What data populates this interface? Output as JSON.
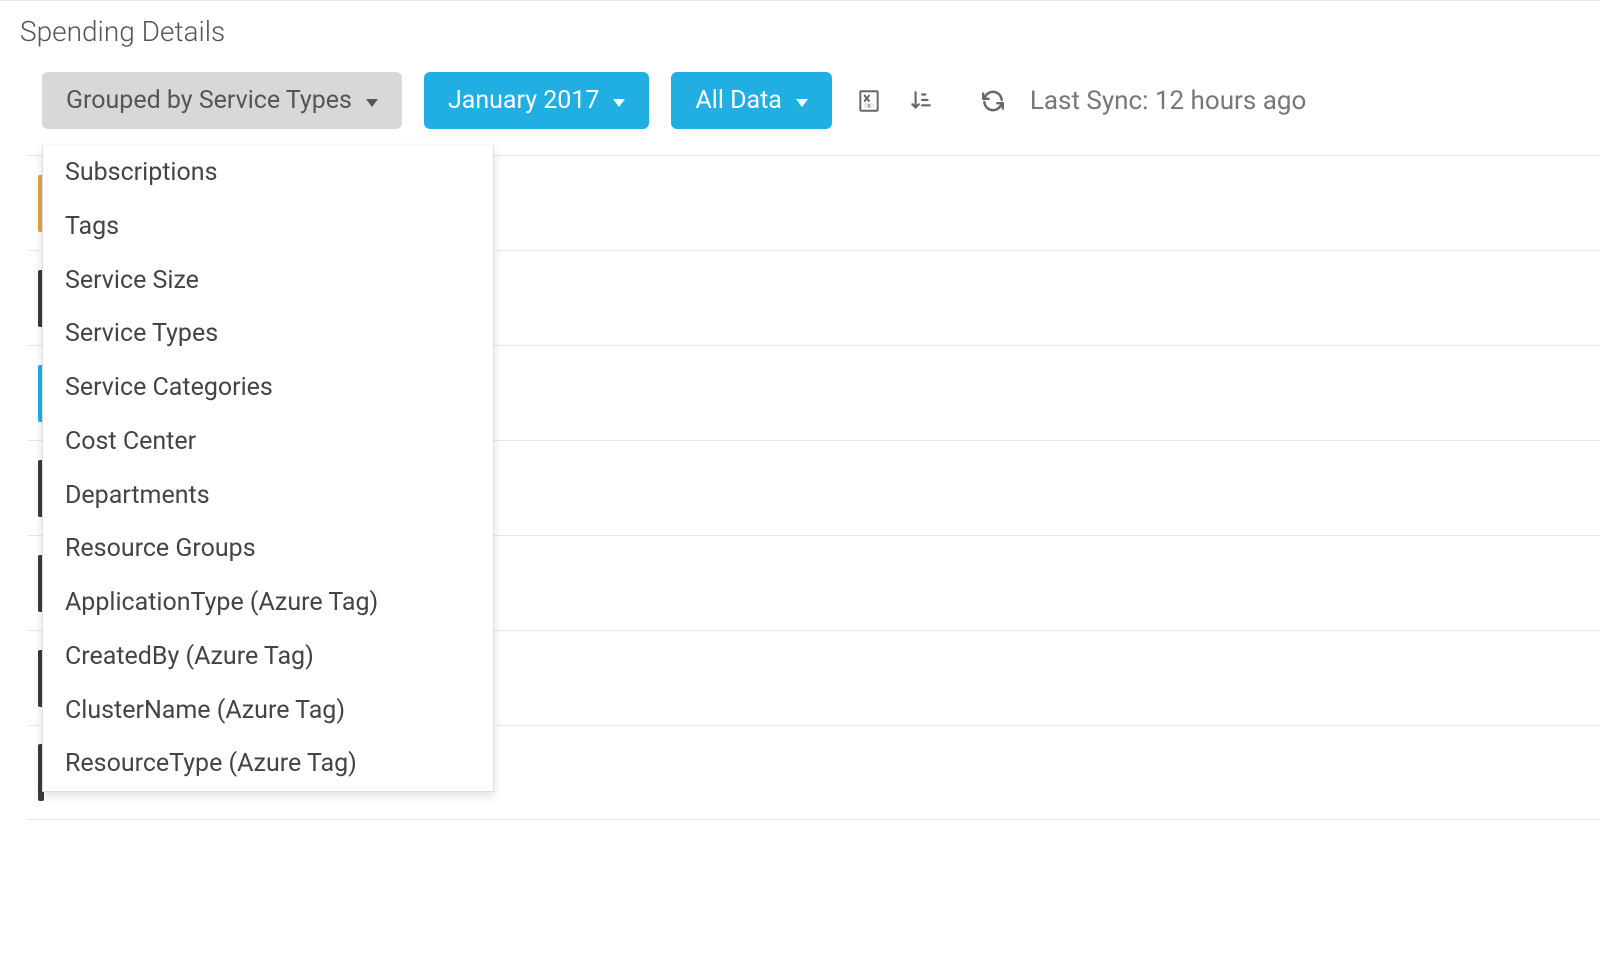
{
  "title": "Spending Details",
  "toolbar": {
    "group_by_label": "Grouped by Service Types",
    "period_label": "January 2017",
    "data_filter_label": "All Data",
    "sync_label": "Last Sync: 12 hours ago"
  },
  "group_by_options": [
    "Subscriptions",
    "Tags",
    "Service Size",
    "Service Types",
    "Service Categories",
    "Cost Center",
    "Departments",
    "Resource Groups",
    "ApplicationType (Azure Tag)",
    "CreatedBy (Azure Tag)",
    "ClusterName (Azure Tag)",
    "ResourceType (Azure Tag)"
  ],
  "row_markers": [
    "#e0a642",
    "#3a3a3a",
    "#20aee3",
    "#3a3a3a",
    "#3a3a3a",
    "#3a3a3a",
    "#3a3a3a"
  ],
  "icons": {
    "export": "export-xls-icon",
    "sort": "sort-icon",
    "refresh": "refresh-icon"
  }
}
